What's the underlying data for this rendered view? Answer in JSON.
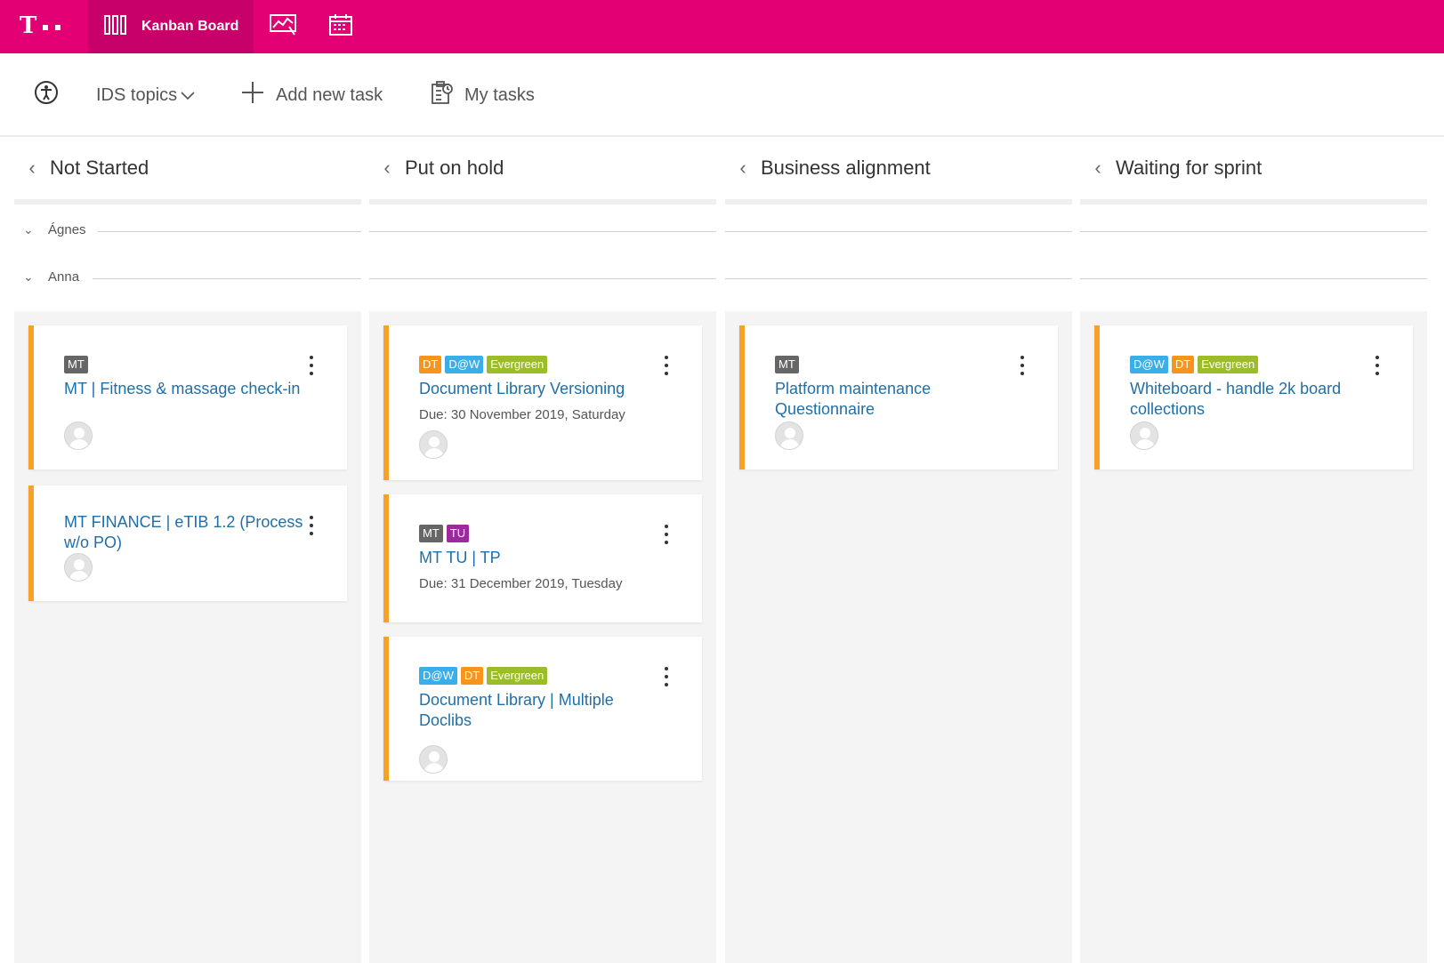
{
  "header": {
    "active_tab_label": "Kanban Board",
    "brand_color": "#e20074",
    "active_tab_color": "#c8006a"
  },
  "toolbar": {
    "topics_label": "IDS topics",
    "add_label": "Add new task",
    "mytasks_label": "My tasks"
  },
  "swimlanes": [
    "Ágnes",
    "Anna"
  ],
  "tag_colors": {
    "MT": "#666666",
    "DT": "#f7941d",
    "D@W": "#3aaee8",
    "Evergreen": "#9bbd2a",
    "TU": "#9b2a9c"
  },
  "columns": [
    {
      "title": "Not Started",
      "cards": [
        {
          "tags": [
            "MT"
          ],
          "title": "MT | Fitness & massage check-in",
          "due": ""
        },
        {
          "tags": [],
          "title": "MT FINANCE | eTIB 1.2 (Process w/o PO)",
          "due": ""
        }
      ]
    },
    {
      "title": "Put on hold",
      "cards": [
        {
          "tags": [
            "DT",
            "D@W",
            "Evergreen"
          ],
          "title": "Document Library Versioning",
          "due": "Due: 30 November 2019, Saturday"
        },
        {
          "tags": [
            "MT",
            "TU"
          ],
          "title": "MT TU | TP",
          "due": "Due: 31 December 2019, Tuesday"
        },
        {
          "tags": [
            "D@W",
            "DT",
            "Evergreen"
          ],
          "title": "Document Library | Multiple Doclibs",
          "due": ""
        }
      ]
    },
    {
      "title": "Business alignment",
      "cards": [
        {
          "tags": [
            "MT"
          ],
          "title": "Platform maintenance Questionnaire",
          "due": ""
        }
      ]
    },
    {
      "title": "Waiting for sprint",
      "cards": [
        {
          "tags": [
            "D@W",
            "DT",
            "Evergreen"
          ],
          "title": "Whiteboard - handle 2k board collections",
          "due": ""
        }
      ]
    }
  ]
}
